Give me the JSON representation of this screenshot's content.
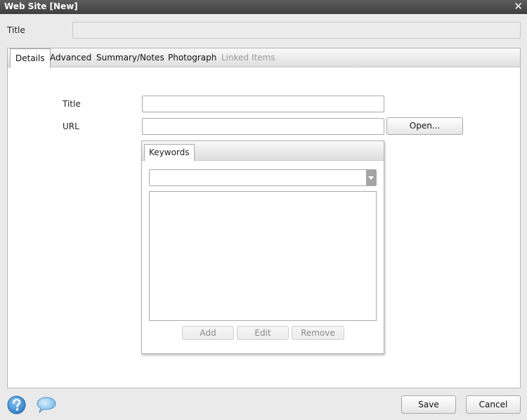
{
  "window": {
    "title": "Web Site [New]",
    "close_glyph": "✕"
  },
  "header": {
    "title_label": "Title",
    "title_value": ""
  },
  "tabs": [
    {
      "label": "Details",
      "state": "active"
    },
    {
      "label": "Advanced",
      "state": "normal"
    },
    {
      "label": "Summary/Notes",
      "state": "normal"
    },
    {
      "label": "Photograph",
      "state": "normal"
    },
    {
      "label": "Linked Items",
      "state": "disabled"
    }
  ],
  "details": {
    "title_label": "Title",
    "title_value": "",
    "url_label": "URL",
    "url_value": "",
    "open_button": "Open..."
  },
  "keywords": {
    "tab_label": "Keywords",
    "selected": "",
    "items": [],
    "add_button": "Add",
    "edit_button": "Edit",
    "remove_button": "Remove"
  },
  "footer": {
    "help_icon": "help-icon",
    "feedback_icon": "speech-bubble-icon",
    "save_button": "Save",
    "cancel_button": "Cancel"
  },
  "colors": {
    "titlebar": "#4a4a4a",
    "background": "#eaeaea",
    "help_blue": "#3a8fd6"
  }
}
